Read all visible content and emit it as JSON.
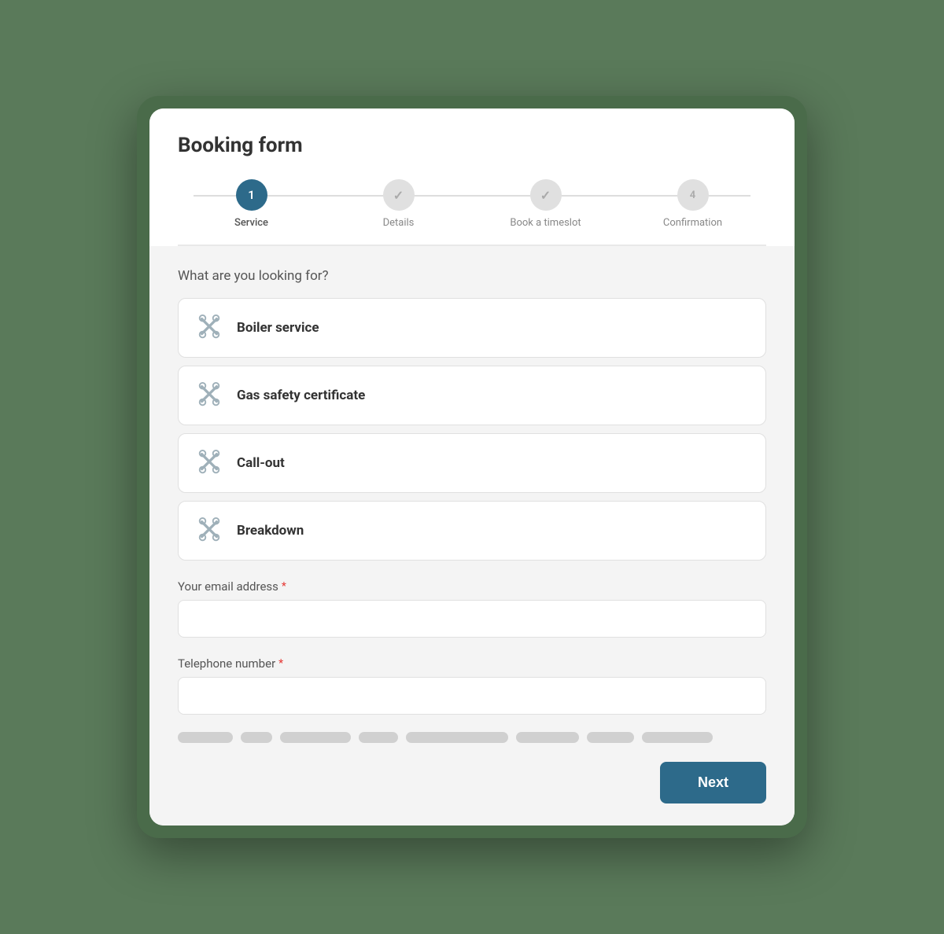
{
  "modal": {
    "title": "Booking form"
  },
  "stepper": {
    "steps": [
      {
        "id": "step-service",
        "number": "1",
        "label": "Service",
        "state": "active"
      },
      {
        "id": "step-details",
        "number": "✓",
        "label": "Details",
        "state": "check"
      },
      {
        "id": "step-timeslot",
        "number": "✓",
        "label": "Book a timeslot",
        "state": "check"
      },
      {
        "id": "step-confirmation",
        "number": "4",
        "label": "Confirmation",
        "state": "inactive"
      }
    ]
  },
  "form": {
    "question": "What are you looking for?",
    "services": [
      {
        "id": "boiler-service",
        "label": "Boiler service"
      },
      {
        "id": "gas-safety",
        "label": "Gas safety certificate"
      },
      {
        "id": "call-out",
        "label": "Call-out"
      },
      {
        "id": "breakdown",
        "label": "Breakdown"
      }
    ],
    "email_label": "Your email address",
    "email_placeholder": "",
    "phone_label": "Telephone number",
    "phone_placeholder": ""
  },
  "footer": {
    "next_label": "Next"
  },
  "skeleton": [
    70,
    40,
    90,
    50,
    130,
    80,
    60,
    90
  ]
}
